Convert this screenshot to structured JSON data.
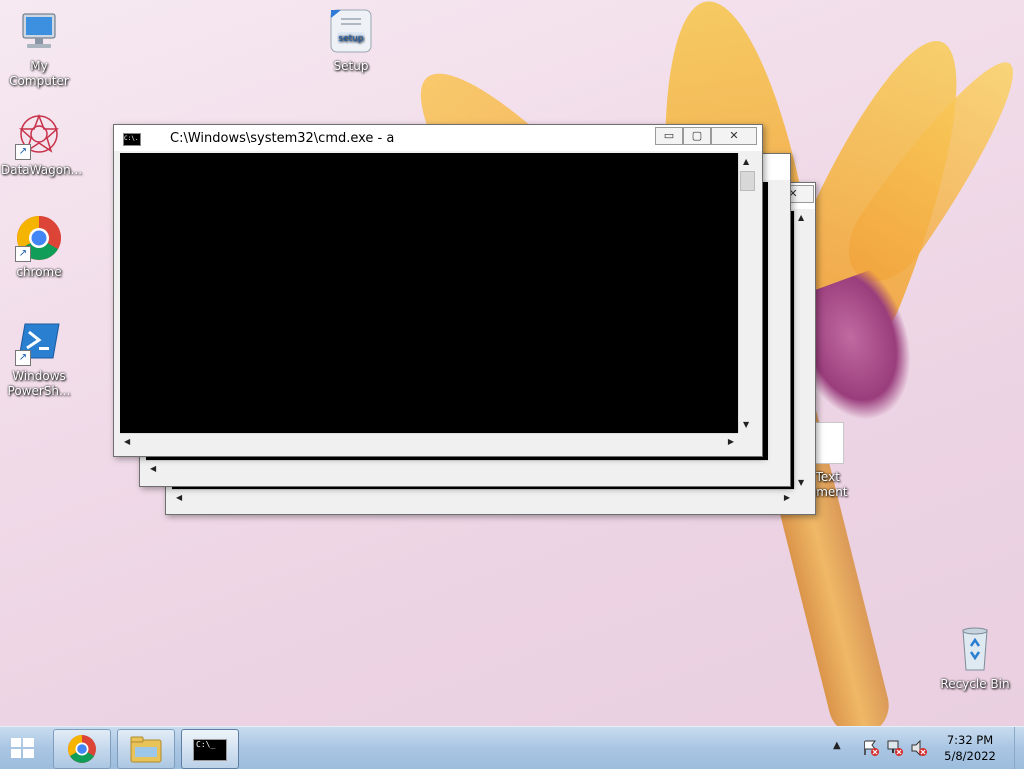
{
  "desktop": {
    "icons": [
      {
        "label": "My Computer"
      },
      {
        "label": "Setup",
        "badge": "setup"
      },
      {
        "label": "DataWagon..."
      },
      {
        "label": "chrome"
      },
      {
        "label": "Windows PowerSh..."
      },
      {
        "label": "Recycle Bin"
      },
      {
        "label_line1": "w Text",
        "label_line2": "cument"
      }
    ]
  },
  "windows": {
    "front": {
      "title": "C:\\Windows\\system32\\cmd.exe - a",
      "icon_text": "C:\\."
    },
    "buttons": {
      "minimize": "▭",
      "maximize": "▢",
      "close": "✕"
    }
  },
  "taskbar": {
    "apps": [
      {
        "icon": "chrome-icon"
      },
      {
        "icon": "file-explorer-icon"
      },
      {
        "icon": "cmd-icon",
        "text": "C:\\_"
      }
    ],
    "clock": {
      "time": "7:32 PM",
      "date": "5/8/2022"
    },
    "tray_icons": [
      "show-hidden-icons",
      "action-center-error-icon",
      "network-icon",
      "volume-muted-icon"
    ]
  },
  "colors": {
    "accent": "#1b5fb4",
    "console": "#000000",
    "taskbar": "#a9c5e3"
  }
}
